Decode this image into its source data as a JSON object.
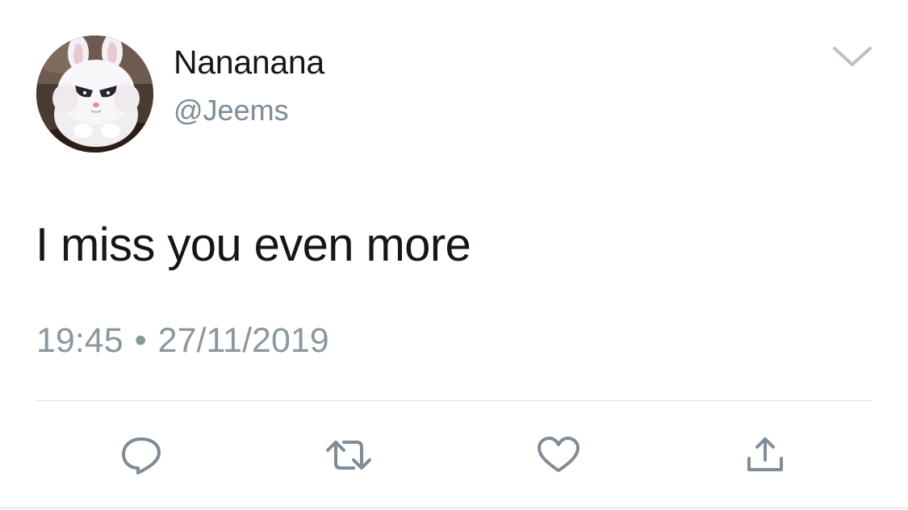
{
  "user": {
    "display_name": "Nananana",
    "handle": "@Jeems"
  },
  "tweet": {
    "text": "I miss you even more",
    "time": "19:45",
    "separator": "•",
    "date": "27/11/2019"
  },
  "icons": {
    "caret": "chevron-down-icon",
    "reply": "reply-icon",
    "retweet": "retweet-icon",
    "like": "heart-icon",
    "share": "share-icon"
  },
  "colors": {
    "icon_gray": "#7f8c96",
    "text": "#14171a",
    "secondary_text": "#8b979f"
  }
}
